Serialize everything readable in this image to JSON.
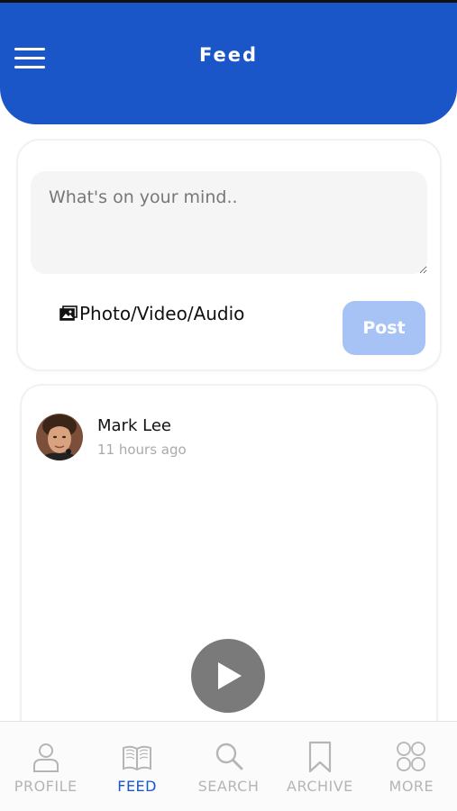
{
  "header": {
    "title": "Feed",
    "menu_icon": "hamburger-menu-icon"
  },
  "composer": {
    "placeholder": "What's on your mind..",
    "value": "",
    "media_label": "Photo/Video/Audio",
    "media_icon": "photo-gallery-icon",
    "post_label": "Post"
  },
  "post": {
    "author": "Mark Lee",
    "time": "11 hours ago",
    "media": "video",
    "play_icon": "play-icon"
  },
  "nav": {
    "active": "FEED",
    "items": [
      {
        "label": "PROFILE",
        "icon": "person-icon"
      },
      {
        "label": "FEED",
        "icon": "open-book-icon"
      },
      {
        "label": "SEARCH",
        "icon": "search-icon"
      },
      {
        "label": "ARCHIVE",
        "icon": "bookmark-icon"
      },
      {
        "label": "MORE",
        "icon": "grid-circles-icon"
      }
    ]
  },
  "colors": {
    "primary": "#1a56c8",
    "post_button": "#a7c3f5",
    "inactive_nav": "#b5b5b5",
    "play_button": "#7a7a7a"
  }
}
